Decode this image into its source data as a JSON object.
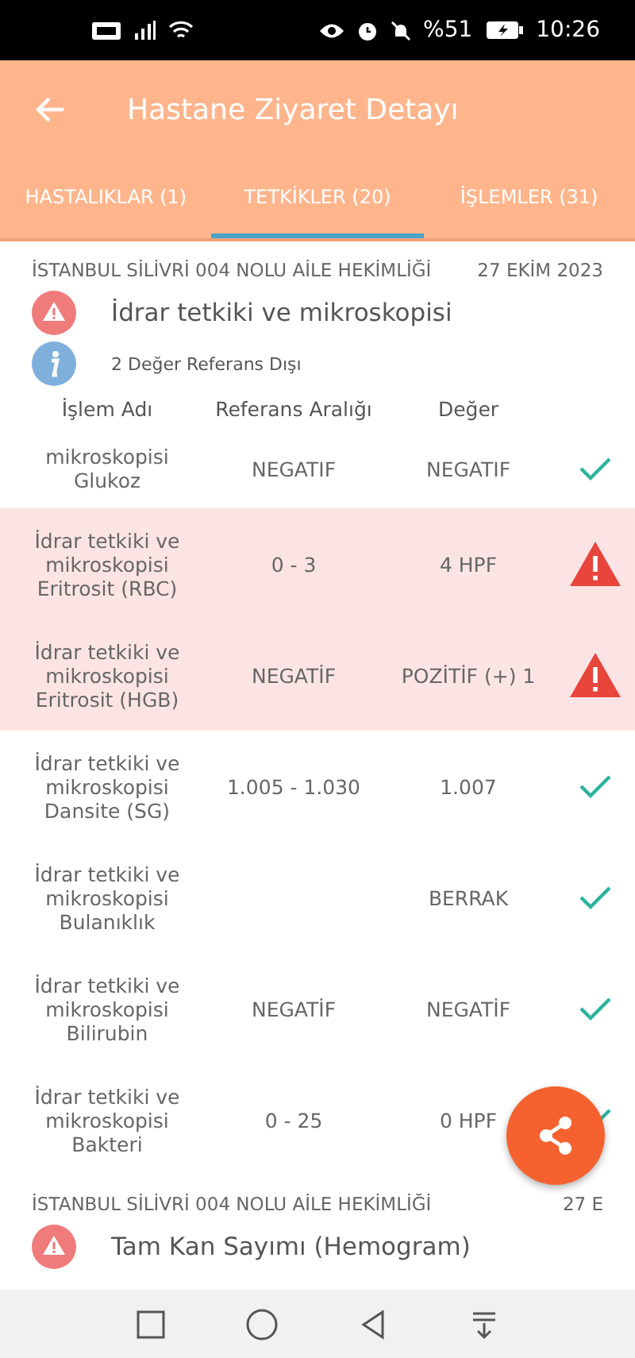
{
  "status_bar": {
    "battery_text": "%51",
    "time": "10:26"
  },
  "app_bar": {
    "title": "Hastane Ziyaret Detayı"
  },
  "tabs": [
    {
      "label": "HASTALIKLAR (1)",
      "selected": false
    },
    {
      "label": "TETKİKLER (20)",
      "selected": true
    },
    {
      "label": "İŞLEMLER (31)",
      "selected": false
    }
  ],
  "groups": [
    {
      "facility": "İSTANBUL SİLİVRİ 004 NOLU AİLE HEKİMLİĞİ",
      "date": "27 EKİM 2023",
      "title": "İdrar tetkiki ve mikroskopisi",
      "note": "2 Değer Referans Dışı",
      "columns": [
        "İşlem Adı",
        "Referans Aralığı",
        "Değer"
      ],
      "rows": [
        {
          "name": "mikroskopisi Glukoz",
          "range": "NEGATIF",
          "value": "NEGATIF",
          "out_of_range": false
        },
        {
          "name": "İdrar tetkiki ve mikroskopisi Eritrosit (RBC)",
          "range": "0 - 3",
          "value": "4 HPF",
          "out_of_range": true
        },
        {
          "name": "İdrar tetkiki ve mikroskopisi Eritrosit (HGB)",
          "range": "NEGATİF",
          "value": "POZİTİF (+) 1",
          "out_of_range": true
        },
        {
          "name": "İdrar tetkiki ve mikroskopisi Dansite (SG)",
          "range": "1.005 - 1.030",
          "value": "1.007",
          "out_of_range": false
        },
        {
          "name": "İdrar tetkiki ve mikroskopisi Bulanıklık",
          "value": "BERRAK",
          "out_of_range": false
        },
        {
          "name": "İdrar tetkiki ve mikroskopisi Bilirubin",
          "range": "NEGATİF",
          "value": "NEGATİF",
          "out_of_range": false
        },
        {
          "name": "İdrar tetkiki ve mikroskopisi Bakteri",
          "range": "0 - 25",
          "value": "0 HPF",
          "out_of_range": false
        }
      ]
    },
    {
      "facility": "İSTANBUL SİLİVRİ 004 NOLU AİLE HEKİMLİĞİ",
      "date": "27 E",
      "title": "Tam Kan Sayımı (Hemogram)"
    }
  ]
}
